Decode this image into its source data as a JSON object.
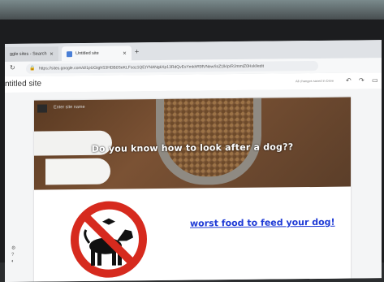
{
  "browser": {
    "tabs": [
      {
        "label": "ggle sites - Search",
        "active": false
      },
      {
        "label": "Untitled site",
        "active": true
      }
    ],
    "new_tab_label": "+",
    "url": "https://sites.google.com/d/1pUGtghS3HDB0SeKLFsoz1QEtYNANgkXp13RdQvEsYmkhR9fVNewSsZ1lk/p/RJmmtZ0Hxkl/edit"
  },
  "editor": {
    "site_title": "ntitled site",
    "saved_note": "All changes saved in Drive"
  },
  "hero": {
    "site_name_placeholder": "Enter site name",
    "heading": "Do you know how to look after a dog??"
  },
  "content": {
    "link_text": "worst food to feed your dog!"
  },
  "colors": {
    "link": "#1f3bd6",
    "no_sign_red": "#d62a1e"
  }
}
